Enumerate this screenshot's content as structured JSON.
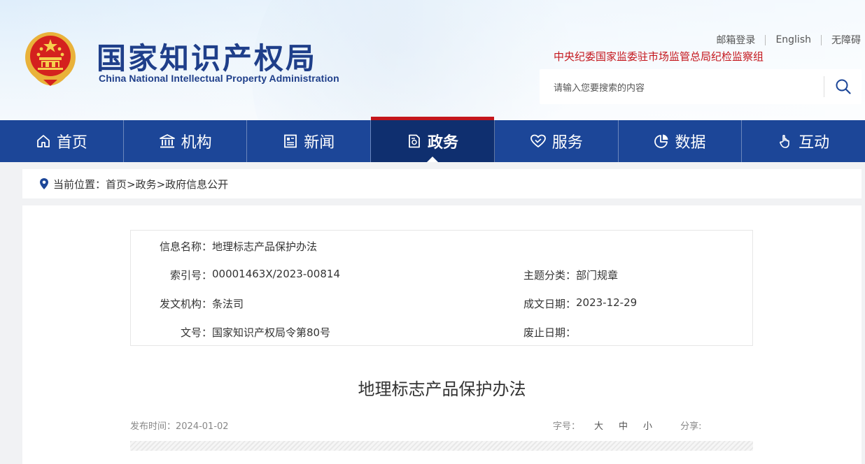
{
  "header": {
    "logo_cn": "国家知识产权局",
    "logo_en": "China National Intellectual Property Administration",
    "top_links": [
      "邮箱登录",
      "English",
      "无障碍"
    ],
    "discipline_link": "中央纪委国家监委驻市场监管总局纪检监察组",
    "search": {
      "placeholder": "请输入您要搜索的内容"
    }
  },
  "nav": [
    {
      "label": "首页",
      "icon": "home-icon"
    },
    {
      "label": "机构",
      "icon": "institution-icon"
    },
    {
      "label": "新闻",
      "icon": "news-icon"
    },
    {
      "label": "政务",
      "icon": "document-icon",
      "active": true
    },
    {
      "label": "服务",
      "icon": "heart-hand-icon"
    },
    {
      "label": "数据",
      "icon": "pie-chart-icon"
    },
    {
      "label": "互动",
      "icon": "hand-pointer-icon"
    }
  ],
  "breadcrumb": {
    "text": "当前位置：首页>政务>政府信息公开"
  },
  "info": {
    "name_label": "信息名称：",
    "name_value": "地理标志产品保护办法",
    "index_label": "索引号：",
    "index_value": "00001463X/2023-00814",
    "topic_label": "主题分类：",
    "topic_value": "部门规章",
    "issuer_label": "发文机构：",
    "issuer_value": "条法司",
    "date_label": "成文日期：",
    "date_value": "2023-12-29",
    "docno_label": "文号：",
    "docno_value": "国家知识产权局令第80号",
    "abolish_label": "废止日期：",
    "abolish_value": ""
  },
  "article": {
    "title": "地理标志产品保护办法",
    "publish": "发布时间：2024-01-02",
    "font_size_label": "字号：",
    "font_sizes": [
      "大",
      "中",
      "小"
    ],
    "share_label": "分享:"
  },
  "colors": {
    "nav_bg": "#1c4698",
    "nav_active": "#0f2f6f",
    "accent_red": "#c4161c",
    "logo_blue": "#1f3f8a"
  }
}
